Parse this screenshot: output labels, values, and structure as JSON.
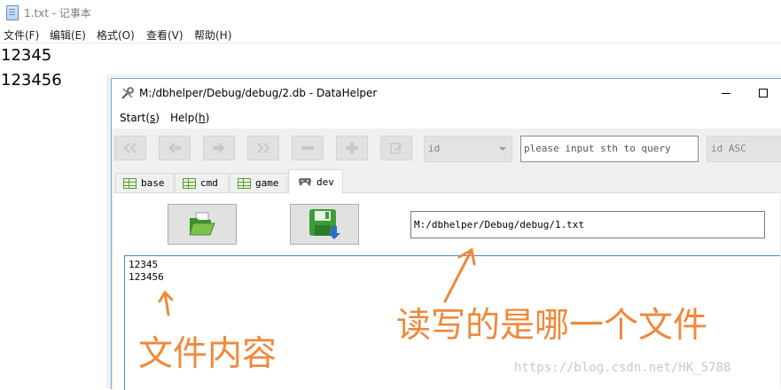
{
  "notepad": {
    "title": "1.txt - 记事本",
    "menu": [
      "文件(F)",
      "编辑(E)",
      "格式(O)",
      "查看(V)",
      "帮助(H)"
    ],
    "lines": [
      "12345",
      "123456"
    ]
  },
  "datahelper": {
    "title": "M:/dbhelper/Debug/debug/2.db - DataHelper",
    "menu": [
      {
        "label": "Start(",
        "key": "s",
        "tail": ")"
      },
      {
        "label": "Help(",
        "key": "h",
        "tail": ")"
      }
    ],
    "toolbar": {
      "field_select": "id",
      "query_placeholder": "please input sth to query",
      "sort_select": "id ASC"
    },
    "tabs": [
      "base",
      "cmd",
      "game",
      "dev"
    ],
    "active_tab": "dev",
    "file_path": "M:/dbhelper/Debug/debug/1.txt",
    "content_lines": [
      "12345",
      "123456"
    ]
  },
  "annotations": {
    "which_file": "读写的是哪一个文件",
    "file_content": "文件内容",
    "color": "#f0883a"
  },
  "watermark": "https://blog.csdn.net/HK_5788"
}
